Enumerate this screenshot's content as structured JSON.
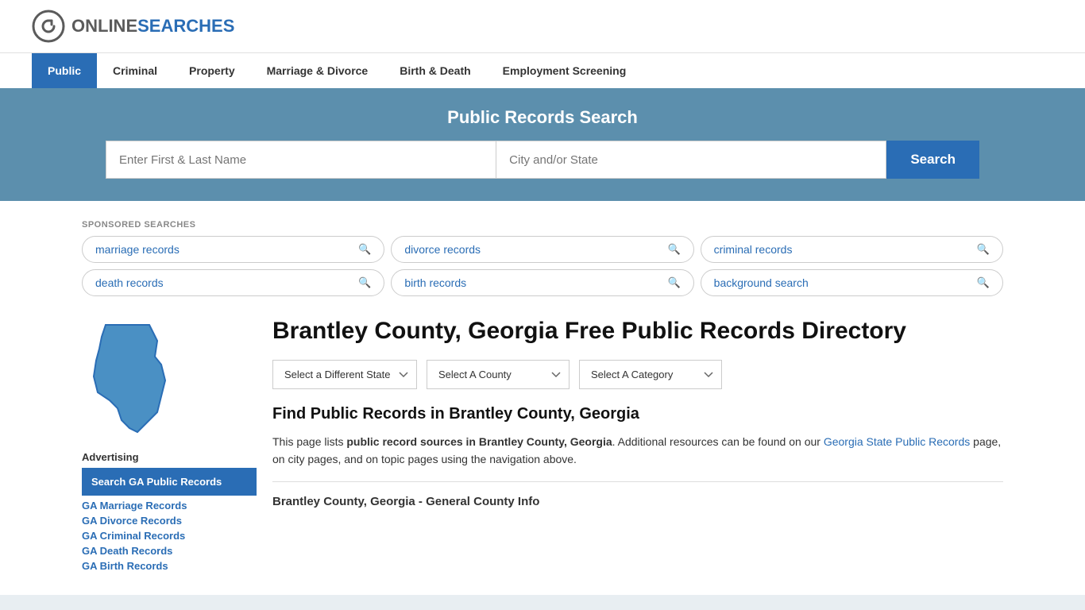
{
  "header": {
    "logo_online": "ONLINE",
    "logo_searches": "SEARCHES"
  },
  "nav": {
    "items": [
      {
        "label": "Public",
        "active": true
      },
      {
        "label": "Criminal",
        "active": false
      },
      {
        "label": "Property",
        "active": false
      },
      {
        "label": "Marriage & Divorce",
        "active": false
      },
      {
        "label": "Birth & Death",
        "active": false
      },
      {
        "label": "Employment Screening",
        "active": false
      }
    ]
  },
  "search_banner": {
    "title": "Public Records Search",
    "name_placeholder": "Enter First & Last Name",
    "location_placeholder": "City and/or State",
    "button_label": "Search"
  },
  "sponsored": {
    "label": "SPONSORED SEARCHES",
    "items": [
      {
        "text": "marriage records"
      },
      {
        "text": "divorce records"
      },
      {
        "text": "criminal records"
      },
      {
        "text": "death records"
      },
      {
        "text": "birth records"
      },
      {
        "text": "background search"
      }
    ]
  },
  "sidebar": {
    "advertising_label": "Advertising",
    "ad_box_text": "Search GA Public Records",
    "links": [
      {
        "text": "GA Marriage Records"
      },
      {
        "text": "GA Divorce Records"
      },
      {
        "text": "GA Criminal Records"
      },
      {
        "text": "GA Death Records"
      },
      {
        "text": "GA Birth Records"
      }
    ]
  },
  "main": {
    "page_title": "Brantley County, Georgia Free Public Records Directory",
    "dropdowns": {
      "state_label": "Select a Different State",
      "county_label": "Select A County",
      "category_label": "Select A Category"
    },
    "find_title": "Find Public Records in Brantley County, Georgia",
    "find_text_1": "This page lists ",
    "find_text_bold": "public record sources in Brantley County, Georgia",
    "find_text_2": ". Additional resources can be found on our ",
    "find_link_text": "Georgia State Public Records",
    "find_text_3": " page, on city pages, and on topic pages using the navigation above.",
    "section_subtitle": "Brantley County, Georgia - General County Info"
  }
}
